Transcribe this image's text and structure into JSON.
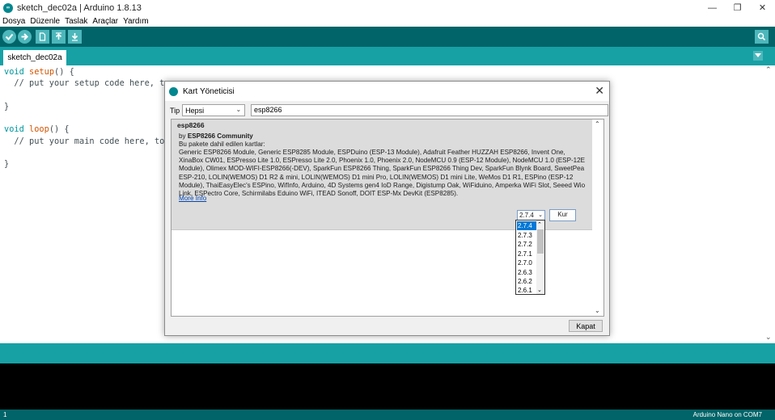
{
  "window": {
    "title": "sketch_dec02a | Arduino 1.8.13",
    "controls": {
      "minimize": "—",
      "restore": "❐",
      "close": "✕"
    }
  },
  "menu": [
    "Dosya",
    "Düzenle",
    "Taslak",
    "Araçlar",
    "Yardım"
  ],
  "toolbar": {
    "buttons": [
      "verify-icon",
      "upload-icon",
      "new-icon",
      "open-icon",
      "save-icon"
    ],
    "serial_monitor": "serial-monitor-icon"
  },
  "tabs": {
    "active": "sketch_dec02a"
  },
  "editor": {
    "lines": [
      {
        "kw": "void",
        "fn": "setup",
        "rest": "() {"
      },
      {
        "text": "  // put your setup code here, to r"
      },
      {
        "text": ""
      },
      {
        "text": "}"
      },
      {
        "text": ""
      },
      {
        "kw": "void",
        "fn": "loop",
        "rest": "() {"
      },
      {
        "text": "  // put your main code here, to ru"
      },
      {
        "text": ""
      },
      {
        "text": "}"
      }
    ]
  },
  "status": {
    "line": "1",
    "board": "Arduino Nano on COM7"
  },
  "dialog": {
    "title": "Kart Yöneticisi",
    "type_label": "Tip",
    "type_value": "Hepsi",
    "search_value": "esp8266",
    "package": {
      "name": "esp8266",
      "by_prefix": "by",
      "author": "ESP8266 Community",
      "included_label": "Bu pakete dahil edilen kartlar:",
      "boards": "Generic ESP8266 Module, Generic ESP8285 Module, ESPDuino (ESP-13 Module), Adafruit Feather HUZZAH ESP8266, Invent One, XinaBox CW01, ESPresso Lite 1.0, ESPresso Lite 2.0, Phoenix 1.0, Phoenix 2.0, NodeMCU 0.9 (ESP-12 Module), NodeMCU 1.0 (ESP-12E Module), Olimex MOD-WIFI-ESP8266(-DEV), SparkFun ESP8266 Thing, SparkFun ESP8266 Thing Dev, SparkFun Blynk Board, SweetPea ESP-210, LOLIN(WEMOS) D1 R2 & mini, LOLIN(WEMOS) D1 mini Pro, LOLIN(WEMOS) D1 mini Lite, WeMos D1 R1, ESPino (ESP-12 Module), ThaiEasyElec's ESPino, WifInfo, Arduino, 4D Systems gen4 IoD Range, Digistump Oak, WiFiduino, Amperka WiFi Slot, Seeed Wio Link, ESPectro Core, Schirmilabs Eduino WiFi, ITEAD Sonoff, DOIT ESP-Mx DevKit (ESP8285).",
      "more_info": "More Info",
      "selected_version": "2.7.4",
      "install_label": "Kur"
    },
    "versions": [
      "2.7.4",
      "2.7.3",
      "2.7.2",
      "2.7.1",
      "2.7.0",
      "2.6.3",
      "2.6.2",
      "2.6.1"
    ],
    "close_label": "Kapat"
  }
}
